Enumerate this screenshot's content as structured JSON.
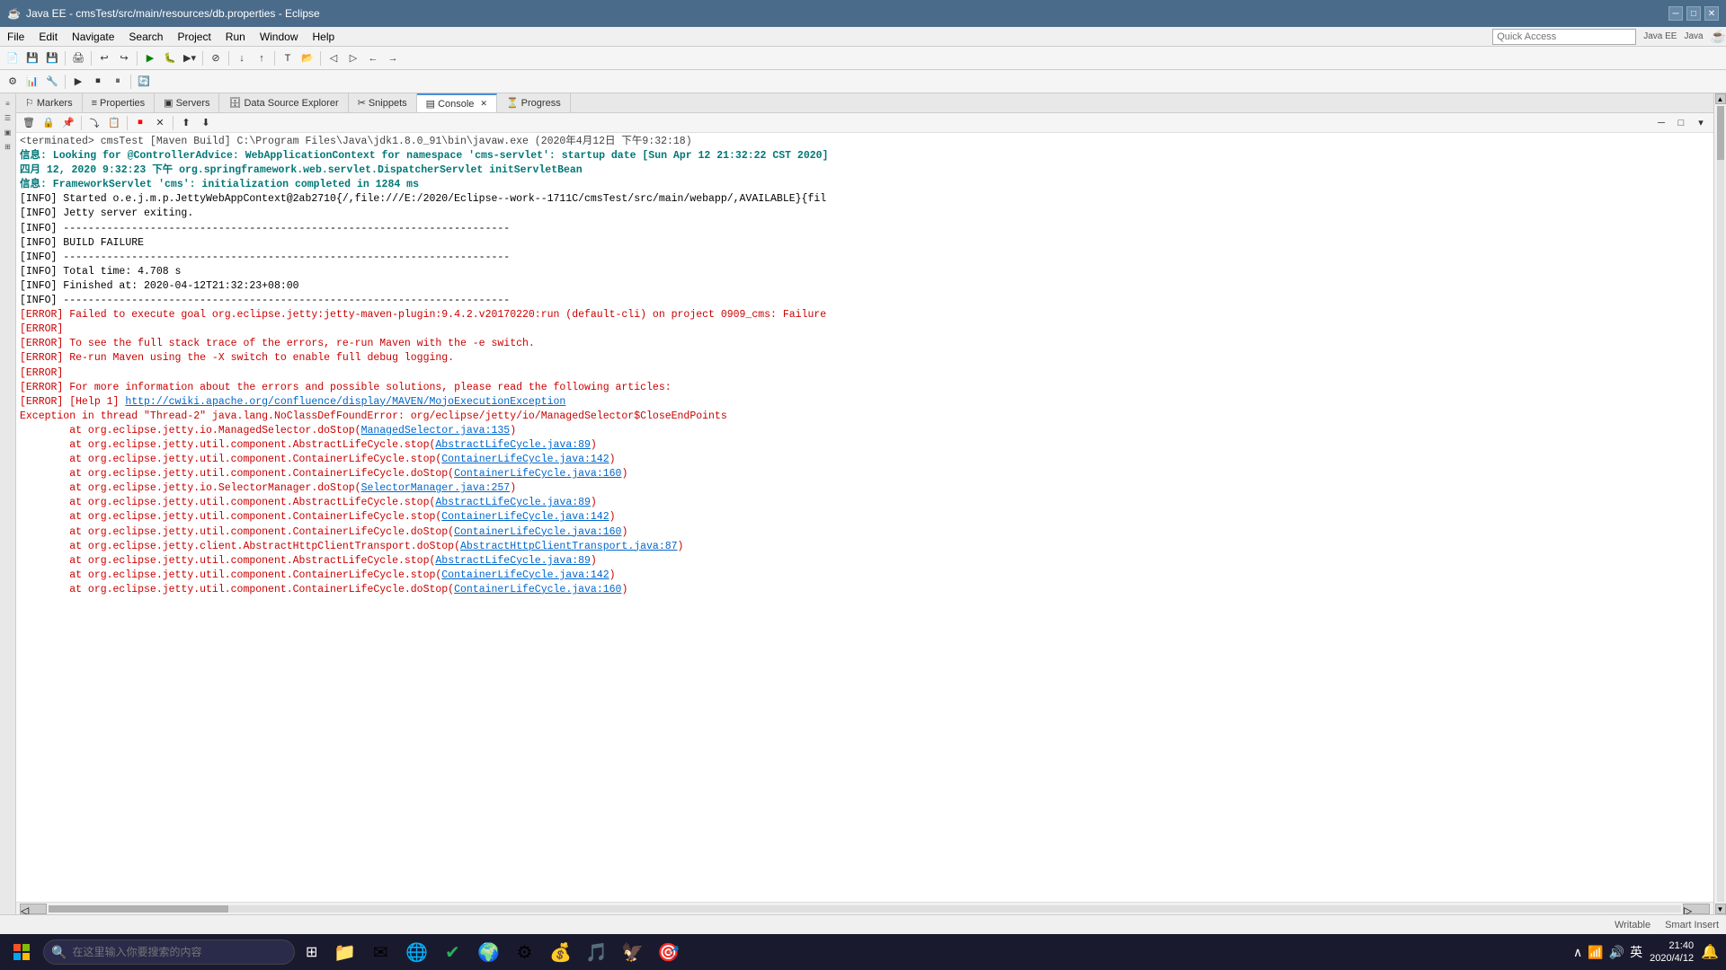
{
  "titlebar": {
    "title": "Java EE - cmsTest/src/main/resources/db.properties - Eclipse",
    "icon": "☕"
  },
  "menubar": {
    "items": [
      "File",
      "Edit",
      "Navigate",
      "Search",
      "Project",
      "Run",
      "Window",
      "Help"
    ]
  },
  "quick_access": {
    "label": "Quick Access",
    "placeholder": "Quick Access"
  },
  "perspectives": [
    "Java EE",
    "Java"
  ],
  "view_tabs": [
    {
      "label": "Markers",
      "icon": "⚐"
    },
    {
      "label": "Properties",
      "icon": "≡"
    },
    {
      "label": "Servers",
      "icon": "▣"
    },
    {
      "label": "Data Source Explorer",
      "icon": "🗄"
    },
    {
      "label": "Snippets",
      "icon": "✂"
    },
    {
      "label": "Console",
      "icon": "▤",
      "active": true
    },
    {
      "label": "Progress",
      "icon": "⏳"
    }
  ],
  "console": {
    "terminated_line": "<terminated> cmsTest [Maven Build] C:\\Program Files\\Java\\jdk1.8.0_91\\bin\\javaw.exe (2020年4月12日 下午9:32:18)",
    "lines": [
      {
        "type": "cyan-bold",
        "text": "信息: Looking for @ControllerAdvice: WebApplicationContext for namespace 'cms-servlet': startup date [Sun Apr 12 21:32:22 CST 2020]"
      },
      {
        "type": "cyan-bold",
        "text": "四月 12, 2020 9:32:23 下午 org.springframework.web.servlet.DispatcherServlet initServletBean"
      },
      {
        "type": "cyan-bold",
        "text": "信息: FrameworkServlet 'cms': initialization completed in 1284 ms"
      },
      {
        "type": "default",
        "text": "[INFO] Started o.e.j.m.p.JettyWebAppContext@2ab2710{/,file:///E:/2020/Eclipse--work--1711C/cmsTest/src/main/webapp/,AVAILABLE}{fil"
      },
      {
        "type": "default",
        "text": "[INFO] Jetty server exiting."
      },
      {
        "type": "default",
        "text": "[INFO] ------------------------------------------------------------------------"
      },
      {
        "type": "default",
        "text": "[INFO] BUILD FAILURE"
      },
      {
        "type": "default",
        "text": "[INFO] ------------------------------------------------------------------------"
      },
      {
        "type": "default",
        "text": "[INFO] Total time: 4.708 s"
      },
      {
        "type": "default",
        "text": "[INFO] Finished at: 2020-04-12T21:32:23+08:00"
      },
      {
        "type": "default",
        "text": "[INFO] ------------------------------------------------------------------------"
      },
      {
        "type": "red",
        "text": "[ERROR] Failed to execute goal org.eclipse.jetty:jetty-maven-plugin:9.4.2.v20170220:run (default-cli) on project 0909_cms: Failure"
      },
      {
        "type": "red",
        "text": "[ERROR]"
      },
      {
        "type": "red",
        "text": "[ERROR] To see the full stack trace of the errors, re-run Maven with the -e switch."
      },
      {
        "type": "red",
        "text": "[ERROR] Re-run Maven using the -X switch to enable full debug logging."
      },
      {
        "type": "red",
        "text": "[ERROR]"
      },
      {
        "type": "red",
        "text": "[ERROR] For more information about the errors and possible solutions, please read the following articles:"
      },
      {
        "type": "red-link",
        "prefix": "[ERROR] [Help 1] ",
        "link": "http://cwiki.apache.org/confluence/display/MAVEN/MojoExecutionException"
      },
      {
        "type": "red-exception",
        "text": "Exception in thread \"Thread-2\" java.lang.NoClassDefFoundError: org/eclipse/jetty/io/ManagedSelector$CloseEndPoints"
      },
      {
        "type": "stack-link",
        "text": "\tat org.eclipse.jetty.io.ManagedSelector.doStop(",
        "link": "ManagedSelector.java:135",
        "suffix": ")"
      },
      {
        "type": "stack-link",
        "text": "\tat org.eclipse.jetty.util.component.AbstractLifeCycle.stop(",
        "link": "AbstractLifeCycle.java:89",
        "suffix": ")"
      },
      {
        "type": "stack-link",
        "text": "\tat org.eclipse.jetty.util.component.ContainerLifeCycle.stop(",
        "link": "ContainerLifeCycle.java:142",
        "suffix": ")"
      },
      {
        "type": "stack-link",
        "text": "\tat org.eclipse.jetty.util.component.ContainerLifeCycle.doStop(",
        "link": "ContainerLifeCycle.java:160",
        "suffix": ")"
      },
      {
        "type": "stack-link",
        "text": "\tat org.eclipse.jetty.io.SelectorManager.doStop(",
        "link": "SelectorManager.java:257",
        "suffix": ")"
      },
      {
        "type": "stack-link",
        "text": "\tat org.eclipse.jetty.util.component.AbstractLifeCycle.stop(",
        "link": "AbstractLifeCycle.java:89",
        "suffix": ")"
      },
      {
        "type": "stack-link",
        "text": "\tat org.eclipse.jetty.util.component.ContainerLifeCycle.stop(",
        "link": "ContainerLifeCycle.java:142",
        "suffix": ")"
      },
      {
        "type": "stack-link",
        "text": "\tat org.eclipse.jetty.util.component.ContainerLifeCycle.doStop(",
        "link": "ContainerLifeCycle.java:160",
        "suffix": ")"
      },
      {
        "type": "stack-link",
        "text": "\tat org.eclipse.jetty.client.AbstractHttpClientTransport.doStop(",
        "link": "AbstractHttpClientTransport.java:87",
        "suffix": ")"
      },
      {
        "type": "stack-link",
        "text": "\tat org.eclipse.jetty.util.component.AbstractLifeCycle.stop(",
        "link": "AbstractLifeCycle.java:89",
        "suffix": ")"
      },
      {
        "type": "stack-link",
        "text": "\tat org.eclipse.jetty.util.component.ContainerLifeCycle.stop(",
        "link": "ContainerLifeCycle.java:142",
        "suffix": ")"
      },
      {
        "type": "stack-link",
        "text": "\tat org.eclipse.jetty.util.component.ContainerLifeCycle.doStop(",
        "link": "ContainerLifeCycle.java:160",
        "suffix": ")"
      }
    ]
  },
  "taskbar": {
    "search_placeholder": "在这里输入你要搜索的内容",
    "apps": [
      "🪟",
      "🔍",
      "📁",
      "✉",
      "🌐",
      "✔",
      "🌍",
      "⚙",
      "💰",
      "🎵",
      "🦅"
    ],
    "tray": [
      "∧",
      "📶",
      "🔊",
      "英"
    ],
    "time": "21:40",
    "date": "2020/4/12"
  }
}
